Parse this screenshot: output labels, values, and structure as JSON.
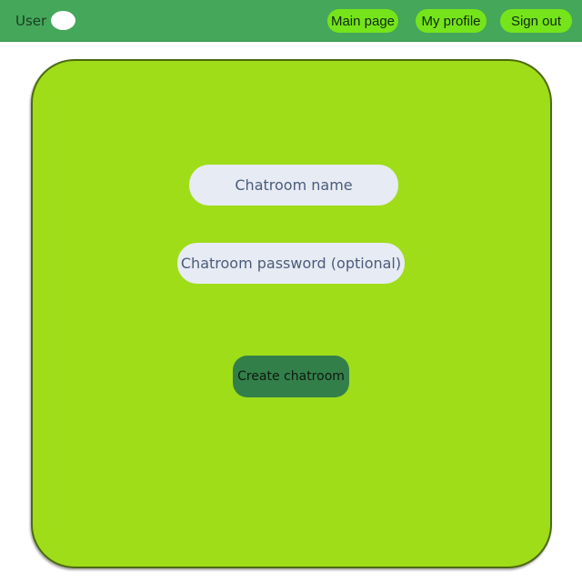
{
  "header": {
    "user_label": "User",
    "nav": {
      "main_page": "Main page",
      "my_profile": "My profile",
      "sign_out": "Sign out"
    }
  },
  "form": {
    "chatroom_name_placeholder": "Chatroom name",
    "chatroom_name_value": "",
    "chatroom_password_placeholder": "Chatroom password (optional)",
    "chatroom_password_value": "",
    "create_button_label": "Create chatroom"
  },
  "colors": {
    "header_bg": "#44a75a",
    "nav_button_bg": "#76e41a",
    "card_bg": "#9fdd19",
    "input_bg": "#e7ebf3",
    "create_button_bg": "#337f4a"
  }
}
